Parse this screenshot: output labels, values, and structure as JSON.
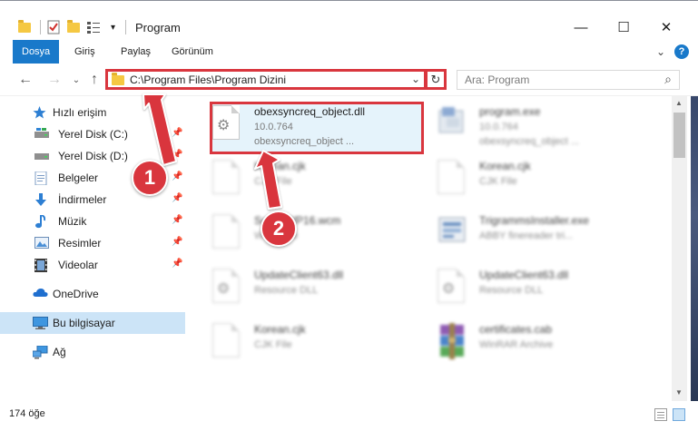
{
  "window": {
    "title": "Program",
    "minimize_glyph": "—",
    "maximize_glyph": "☐",
    "close_glyph": "✕"
  },
  "ribbon": {
    "tabs": [
      {
        "label": "Dosya",
        "active": true
      },
      {
        "label": "Giriş",
        "active": false
      },
      {
        "label": "Paylaş",
        "active": false
      },
      {
        "label": "Görünüm",
        "active": false
      }
    ],
    "expand_glyph": "⌄",
    "help_glyph": "?"
  },
  "navigation": {
    "back_glyph": "←",
    "forward_glyph": "→",
    "recent_glyph": "⌄",
    "up_glyph": "↑",
    "address": "C:\\Program Files\\Program Dizini",
    "dropdown_glyph": "⌄",
    "refresh_glyph": "↻",
    "search_placeholder": "Ara: Program",
    "search_glyph": "⌕"
  },
  "sidebar": {
    "items": [
      {
        "label": "Hızlı erişim",
        "icon": "star-icon",
        "pinned": false
      },
      {
        "label": "Yerel Disk (C:)",
        "icon": "drive-icon",
        "pinned": true
      },
      {
        "label": "Yerel Disk (D:)",
        "icon": "drive-icon",
        "pinned": true
      },
      {
        "label": "Belgeler",
        "icon": "documents-icon",
        "pinned": true
      },
      {
        "label": "İndirmeler",
        "icon": "download-icon",
        "pinned": true
      },
      {
        "label": "Müzik",
        "icon": "music-icon",
        "pinned": true
      },
      {
        "label": "Resimler",
        "icon": "pictures-icon",
        "pinned": true
      },
      {
        "label": "Videolar",
        "icon": "videos-icon",
        "pinned": true
      },
      {
        "label": "OneDrive",
        "icon": "cloud-icon",
        "pinned": false
      },
      {
        "label": "Bu bilgisayar",
        "icon": "computer-icon",
        "pinned": false,
        "selected": true
      },
      {
        "label": "Ağ",
        "icon": "network-icon",
        "pinned": false
      }
    ],
    "pin_glyph": "📌"
  },
  "files": [
    {
      "name": "obexsyncreq_object.dll",
      "line1": "10.0.764",
      "line2": "obexsyncreq_object ...",
      "icon": "dll-icon",
      "highlighted": true
    },
    {
      "name": "program.exe",
      "line1": "10.0.764",
      "line2": "obexsyncreq_object ...",
      "icon": "exe-icon"
    },
    {
      "name": "Korean.cjk",
      "line1": "CJK File",
      "line2": "",
      "icon": "blank-file-icon"
    },
    {
      "name": "Korean.cjk",
      "line1": "CJK File",
      "line2": "",
      "icon": "blank-file-icon"
    },
    {
      "name": "SoundWP16.wcm",
      "line1": "WCM File",
      "line2": "",
      "icon": "blank-file-icon"
    },
    {
      "name": "TrigrammsInstaller.exe",
      "line1": "ABBY finereader tri...",
      "line2": "",
      "icon": "installer-icon"
    },
    {
      "name": "UpdateClient63.dll",
      "line1": "Resource DLL",
      "line2": "",
      "icon": "dll-icon"
    },
    {
      "name": "UpdateClient63.dll",
      "line1": "Resource DLL",
      "line2": "",
      "icon": "dll-icon"
    },
    {
      "name": "Korean.cjk",
      "line1": "CJK File",
      "line2": "",
      "icon": "blank-file-icon"
    },
    {
      "name": "certificates.cab",
      "line1": "WinRAR Archive",
      "line2": "",
      "icon": "winrar-icon"
    }
  ],
  "status": {
    "item_count": "174 öğe"
  },
  "callouts": [
    {
      "number": "1"
    },
    {
      "number": "2"
    }
  ],
  "colors": {
    "accent": "#1979ca",
    "highlight_border": "#d9363e",
    "selection": "#cce4f7"
  }
}
